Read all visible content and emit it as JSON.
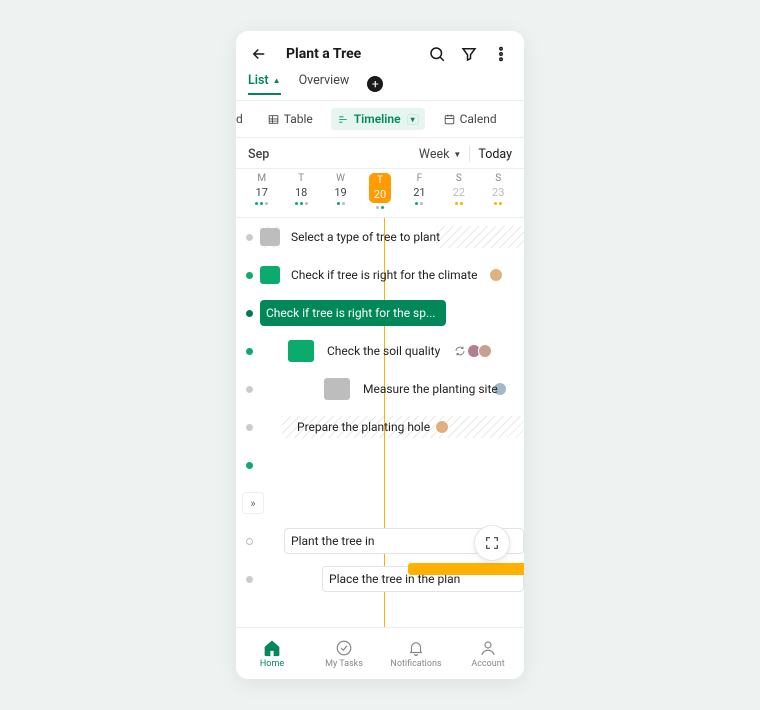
{
  "header": {
    "title": "Plant a Tree"
  },
  "tabs": {
    "list": "List",
    "overview": "Overview"
  },
  "views": {
    "board": "rd",
    "table": "Table",
    "timeline": "Timeline",
    "calendar": "Calend"
  },
  "datenav": {
    "month": "Sep",
    "range": "Week",
    "today": "Today"
  },
  "days": [
    {
      "dow": "M",
      "num": "17"
    },
    {
      "dow": "T",
      "num": "18"
    },
    {
      "dow": "W",
      "num": "19"
    },
    {
      "dow": "T",
      "num": "20"
    },
    {
      "dow": "F",
      "num": "21"
    },
    {
      "dow": "S",
      "num": "22"
    },
    {
      "dow": "S",
      "num": "23"
    }
  ],
  "tasks": {
    "t1": "Select a type of tree to plant",
    "t2": "Check if tree is right for the climate",
    "t3": "Check if tree is right for the sp...",
    "t4": "Check the soil quality",
    "t5": "Measure the planting site",
    "t6": "Prepare the planting hole",
    "t7": "Plant the tree in",
    "t8": "Place the tree in the plan"
  },
  "bottomnav": {
    "home": "Home",
    "mytasks": "My Tasks",
    "notifications": "Notifications",
    "account": "Account"
  }
}
